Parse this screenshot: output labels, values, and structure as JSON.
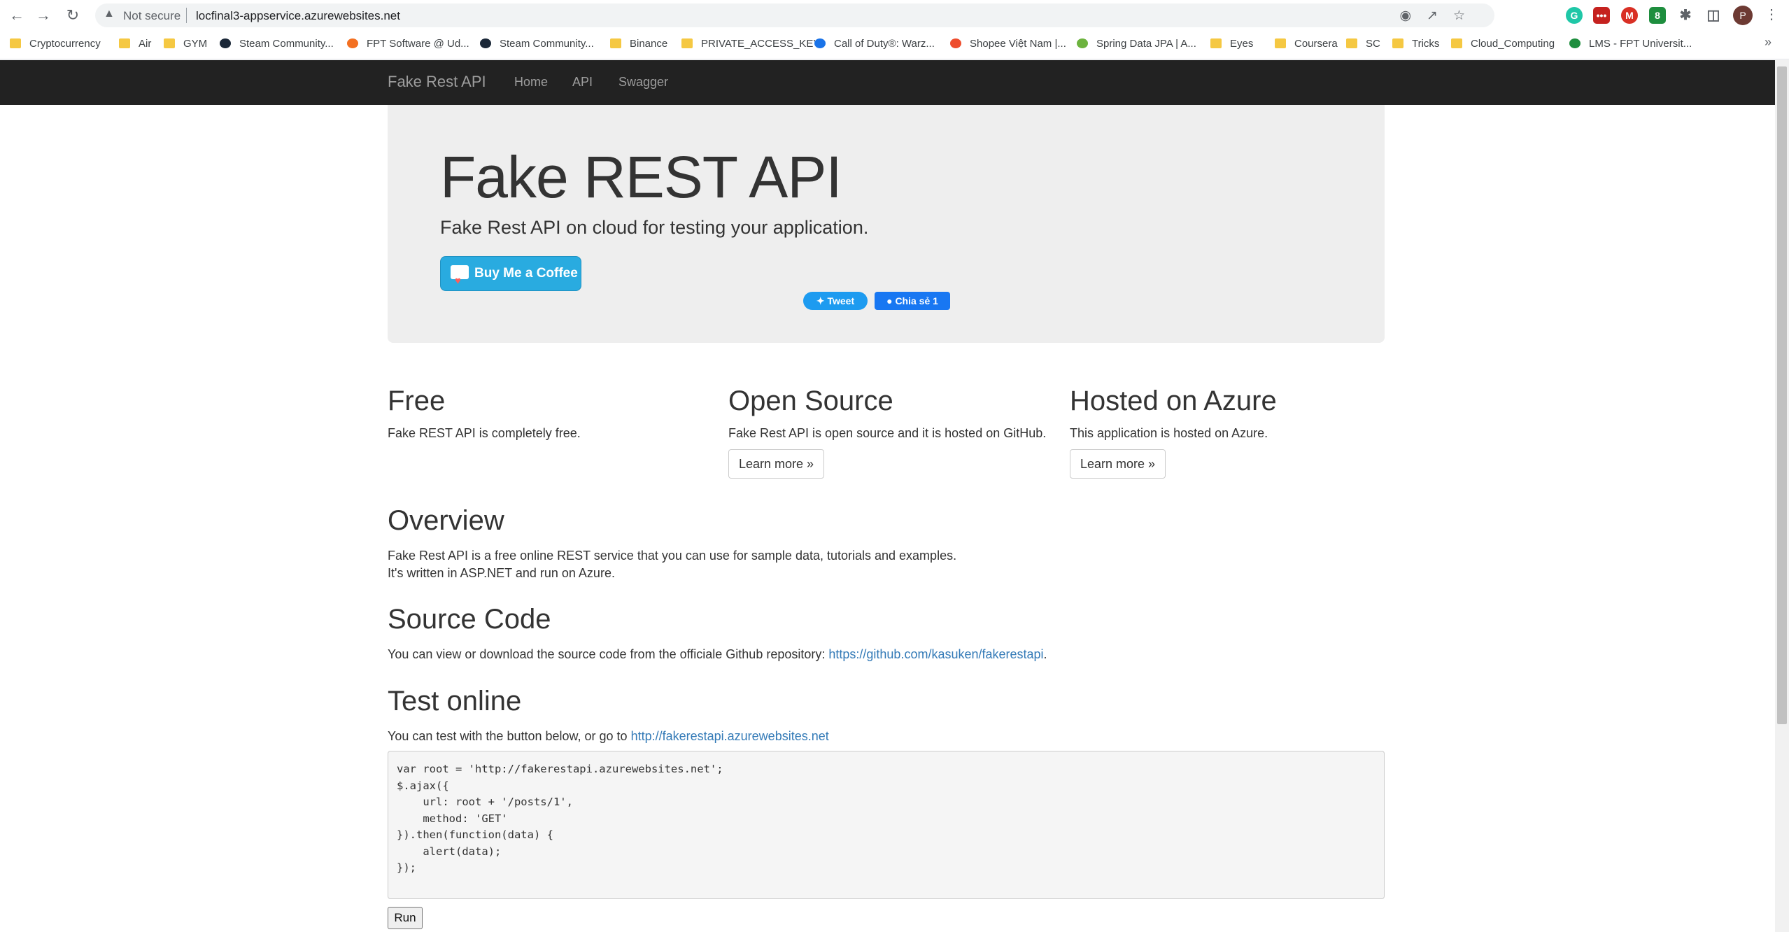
{
  "browser": {
    "security_label": "Not secure",
    "url": "locfinal3-appservice.azurewebsites.net",
    "profile_initial": "P",
    "extension_badge": "8",
    "bookmarks": [
      {
        "label": "Cryptocurrency",
        "icon": "folder-icon"
      },
      {
        "label": "Air",
        "icon": "folder-icon"
      },
      {
        "label": "GYM",
        "icon": "folder-icon"
      },
      {
        "label": "Steam Community...",
        "icon": "steam-icon"
      },
      {
        "label": "FPT Software @ Ud...",
        "icon": "fpt-icon"
      },
      {
        "label": "Steam Community...",
        "icon": "steam-icon"
      },
      {
        "label": "Binance",
        "icon": "folder-icon"
      },
      {
        "label": "PRIVATE_ACCESS_KEY",
        "icon": "folder-icon"
      },
      {
        "label": "Call of Duty®: Warz...",
        "icon": "cod-icon"
      },
      {
        "label": "Shopee Việt Nam |...",
        "icon": "shopee-icon"
      },
      {
        "label": "Spring Data JPA | A...",
        "icon": "spring-icon"
      },
      {
        "label": "Eyes",
        "icon": "folder-icon"
      },
      {
        "label": "Coursera",
        "icon": "folder-icon"
      },
      {
        "label": "SC",
        "icon": "folder-icon"
      },
      {
        "label": "Tricks",
        "icon": "folder-icon"
      },
      {
        "label": "Cloud_Computing",
        "icon": "folder-icon"
      },
      {
        "label": "LMS - FPT Universit...",
        "icon": "lms-icon"
      }
    ],
    "bookmarks_more": "»"
  },
  "navbar": {
    "brand": "Fake Rest API",
    "links": [
      "Home",
      "API",
      "Swagger"
    ]
  },
  "jumbotron": {
    "title": "Fake REST API",
    "tagline": "Fake Rest API on cloud for testing your application.",
    "coffee_button": "Buy Me a Coffee",
    "tweet_button": "Tweet",
    "share_button": "Chia sẻ 1"
  },
  "features": [
    {
      "title": "Free",
      "text": "Fake REST API is completely free.",
      "button": ""
    },
    {
      "title": "Open Source",
      "text": "Fake Rest API is open source and it is hosted on GitHub.",
      "button": "Learn more »"
    },
    {
      "title": "Hosted on Azure",
      "text": "This application is hosted on Azure.",
      "button": "Learn more »"
    }
  ],
  "overview": {
    "title": "Overview",
    "line1": "Fake Rest API is a free online REST service that you can use for sample data, tutorials and examples.",
    "line2": "It's written in ASP.NET and run on Azure."
  },
  "source_code": {
    "title": "Source Code",
    "text": "You can view or download the source code from the officiale Github repository: ",
    "link": "https://github.com/kasuken/fakerestapi",
    "suffix": "."
  },
  "test_online": {
    "title": "Test online",
    "text": "You can test with the button below, or go to ",
    "link": "http://fakerestapi.azurewebsites.net",
    "code": "var root = 'http://fakerestapi.azurewebsites.net';\n$.ajax({\n    url: root + '/posts/1',\n    method: 'GET'\n}).then(function(data) {\n    alert(data);\n});",
    "run_button": "Run"
  }
}
